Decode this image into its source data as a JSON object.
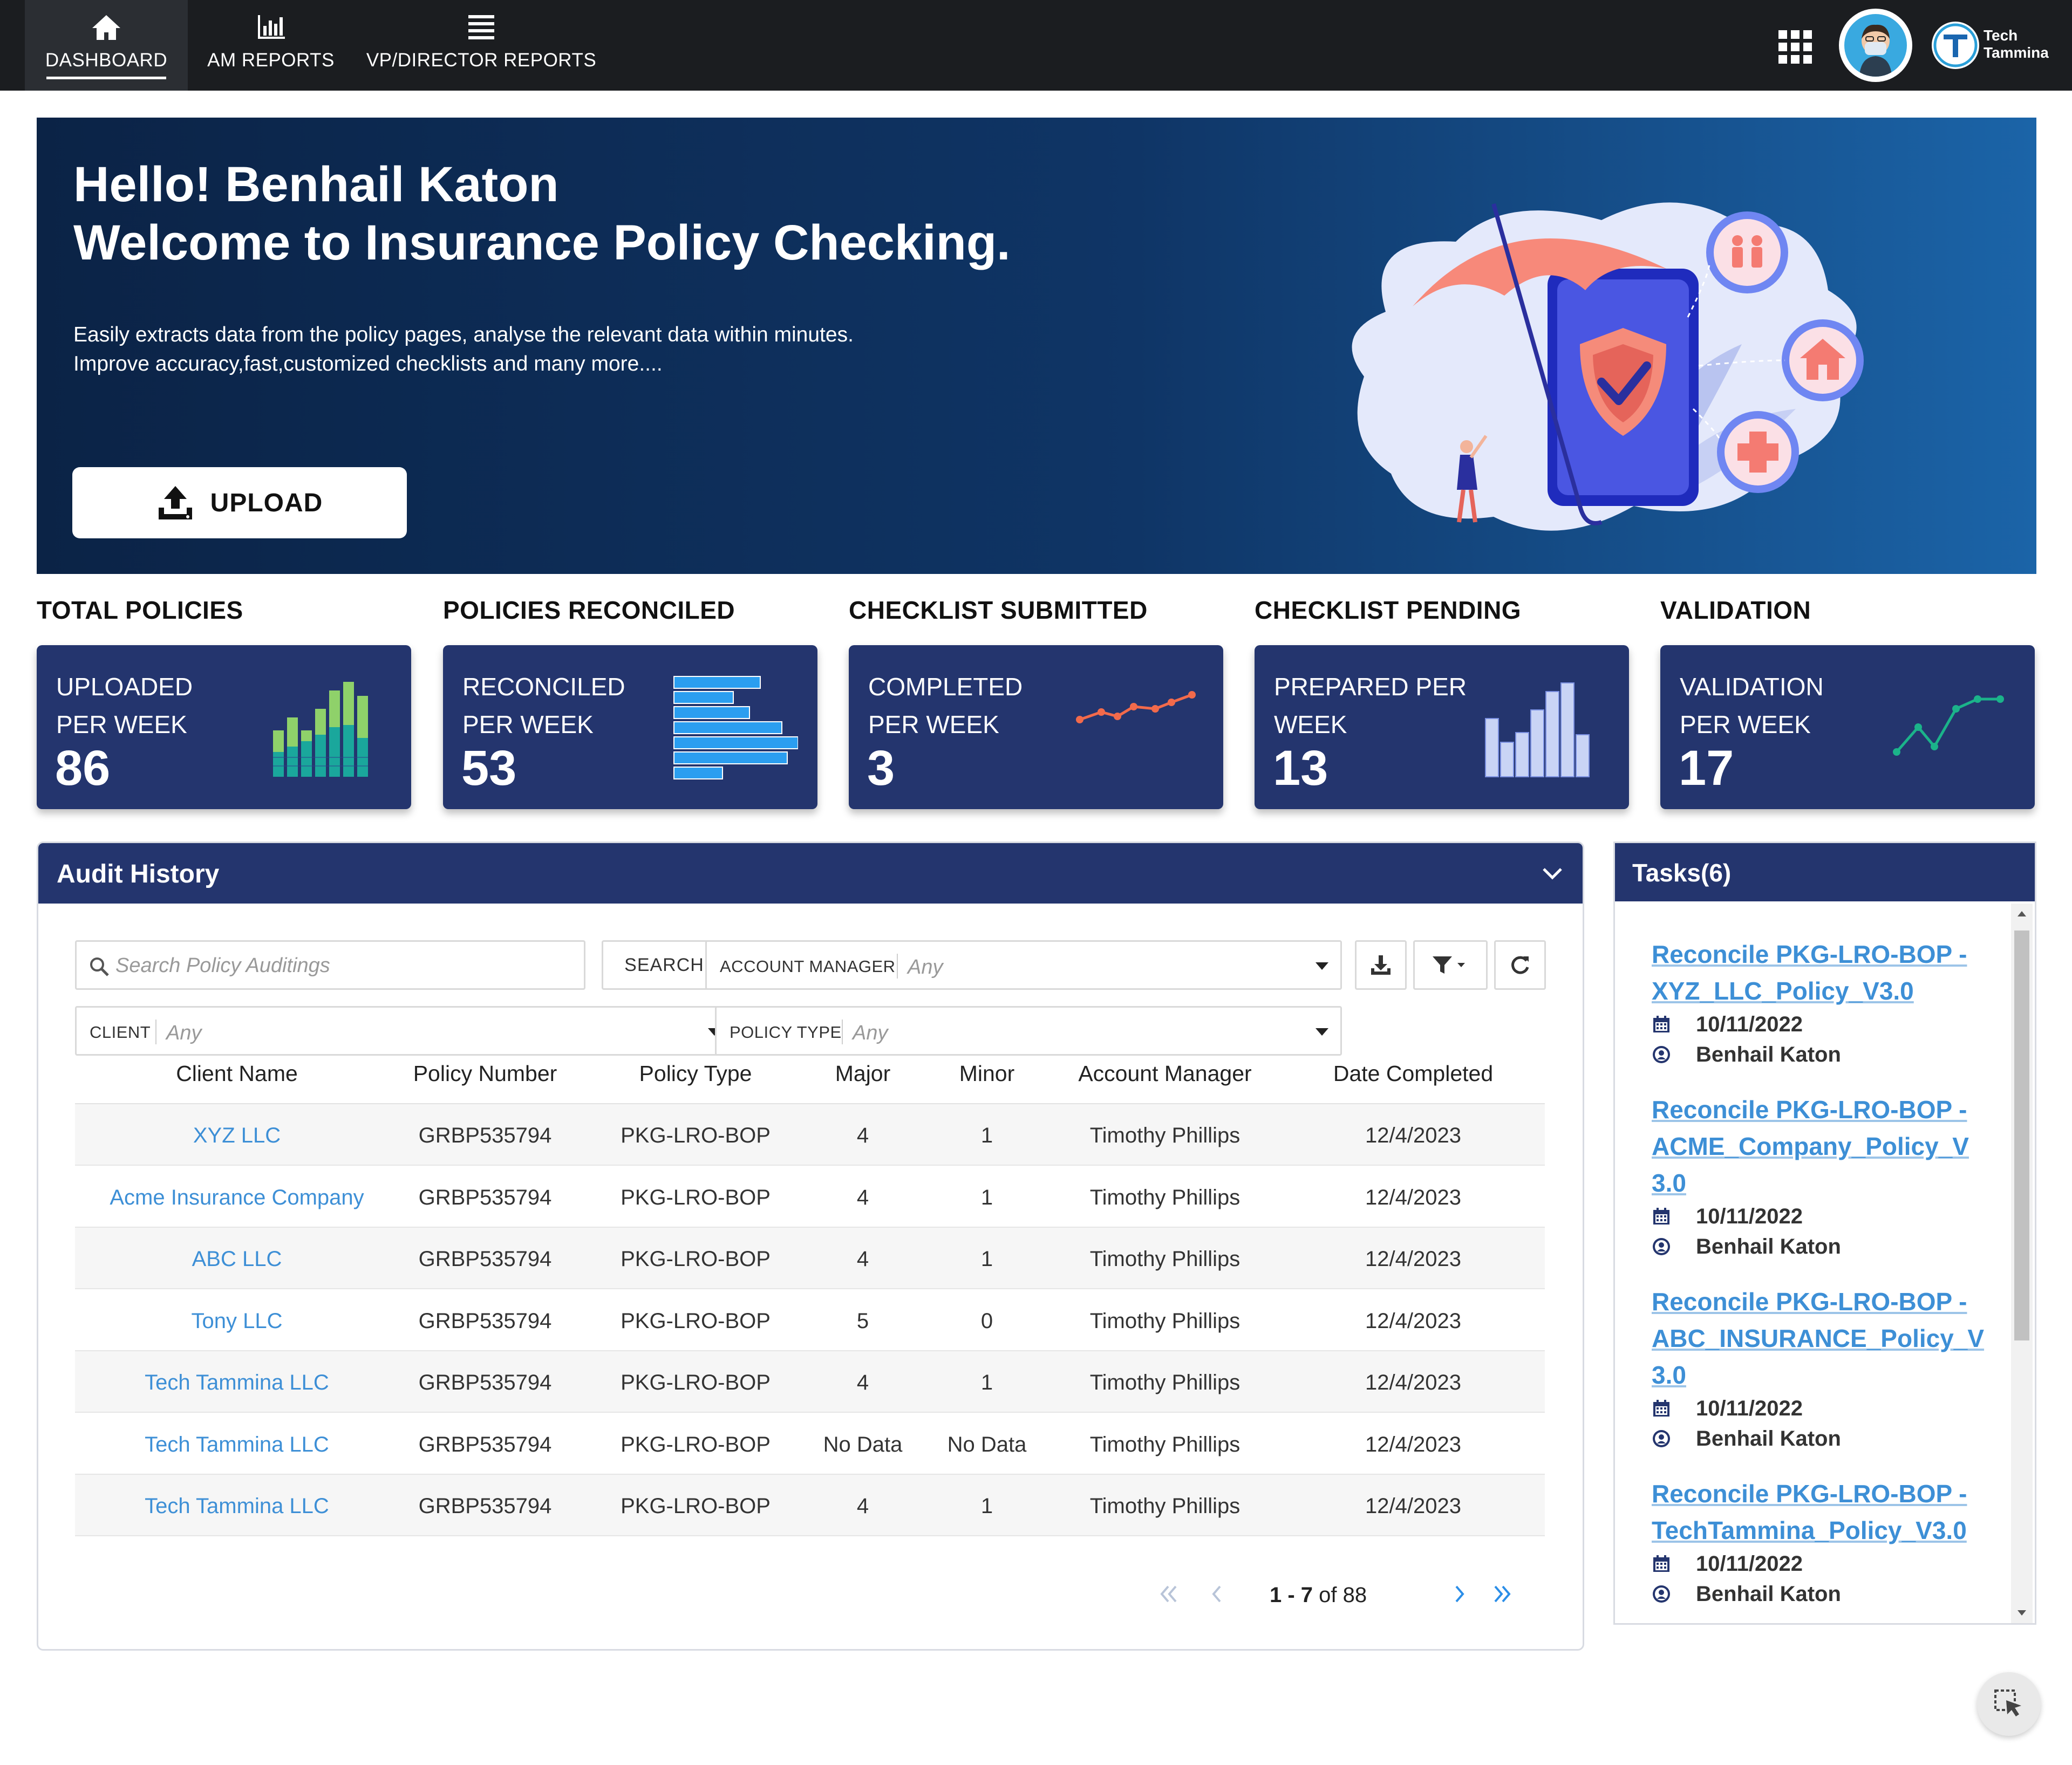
{
  "nav": {
    "items": [
      {
        "label": "DASHBOARD",
        "icon": "home-icon"
      },
      {
        "label": "AM REPORTS",
        "icon": "bar-chart-icon"
      },
      {
        "label": "VP/DIRECTOR REPORTS",
        "icon": "menu-icon"
      }
    ],
    "logo_text": "Tech\nTammina"
  },
  "hero": {
    "title": "Hello! Benhail Katon\nWelcome to Insurance Policy Checking.",
    "subtitle": "Easily extracts data from the policy pages, analyse the relevant data within minutes.\nImprove accuracy,fast,customized checklists and many more....",
    "upload_label": "UPLOAD"
  },
  "stats": [
    {
      "title": "TOTAL POLICIES",
      "label": "UPLOADED\nPER WEEK",
      "value": "86",
      "mini_chart": "stacked-bars"
    },
    {
      "title": "POLICIES RECONCILED",
      "label": "RECONCILED\nPER WEEK",
      "value": "53",
      "mini_chart": "horizontal-bars"
    },
    {
      "title": "CHECKLIST SUBMITTED",
      "label": "COMPLETED\nPER WEEK",
      "value": "3",
      "mini_chart": "line"
    },
    {
      "title": "CHECKLIST PENDING",
      "label": "PREPARED PER\nWEEK",
      "value": "13",
      "mini_chart": "vertical-bars"
    },
    {
      "title": "VALIDATION",
      "label": "VALIDATION\nPER WEEK",
      "value": "17",
      "mini_chart": "line"
    }
  ],
  "audit": {
    "title": "Audit History",
    "search_placeholder": "Search Policy Auditings",
    "search_button": "SEARCH",
    "filters": {
      "account_manager": {
        "label": "ACCOUNT MANAGER",
        "value": "Any"
      },
      "client": {
        "label": "CLIENT",
        "value": "Any"
      },
      "policy_type": {
        "label": "POLICY TYPE",
        "value": "Any"
      }
    },
    "columns": [
      "Client Name",
      "Policy Number",
      "Policy Type",
      "Major",
      "Minor",
      "Account Manager",
      "Date Completed"
    ],
    "rows": [
      [
        "XYZ LLC",
        "GRBP535794",
        "PKG-LRO-BOP",
        "4",
        "1",
        "Timothy Phillips",
        "12/4/2023"
      ],
      [
        "Acme Insurance Company",
        "GRBP535794",
        "PKG-LRO-BOP",
        "4",
        "1",
        "Timothy Phillips",
        "12/4/2023"
      ],
      [
        "ABC LLC",
        "GRBP535794",
        "PKG-LRO-BOP",
        "4",
        "1",
        "Timothy Phillips",
        "12/4/2023"
      ],
      [
        "Tony LLC",
        "GRBP535794",
        "PKG-LRO-BOP",
        "5",
        "0",
        "Timothy Phillips",
        "12/4/2023"
      ],
      [
        "Tech Tammina LLC",
        "GRBP535794",
        "PKG-LRO-BOP",
        "4",
        "1",
        "Timothy Phillips",
        "12/4/2023"
      ],
      [
        "Tech Tammina LLC",
        "GRBP535794",
        "PKG-LRO-BOP",
        "No Data",
        "No Data",
        "Timothy Phillips",
        "12/4/2023"
      ],
      [
        "Tech Tammina LLC",
        "GRBP535794",
        "PKG-LRO-BOP",
        "4",
        "1",
        "Timothy Phillips",
        "12/4/2023"
      ]
    ],
    "pager": {
      "range": "1 - 7",
      "of_label": "of 88"
    }
  },
  "tasks": {
    "title": "Tasks(6)",
    "items": [
      {
        "title": "Reconcile PKG-LRO-BOP - XYZ_LLC_Policy_V3.0",
        "date": "10/11/2022",
        "user": "Benhail Katon"
      },
      {
        "title": "Reconcile PKG-LRO-BOP - ACME_Company_Policy_V3.0",
        "date": "10/11/2022",
        "user": "Benhail Katon"
      },
      {
        "title": "Reconcile PKG-LRO-BOP - ABC_INSURANCE_Policy_V3.0",
        "date": "10/11/2022",
        "user": "Benhail Katon"
      },
      {
        "title": "Reconcile PKG-LRO-BOP - TechTammina_Policy_V3.0",
        "date": "10/11/2022",
        "user": "Benhail Katon"
      }
    ]
  },
  "colors": {
    "nav_bg": "#1b1d20",
    "card_bg": "#24356e",
    "link": "#3d8fd6",
    "hero_start": "#0b2346",
    "hero_end": "#1b64a8"
  }
}
